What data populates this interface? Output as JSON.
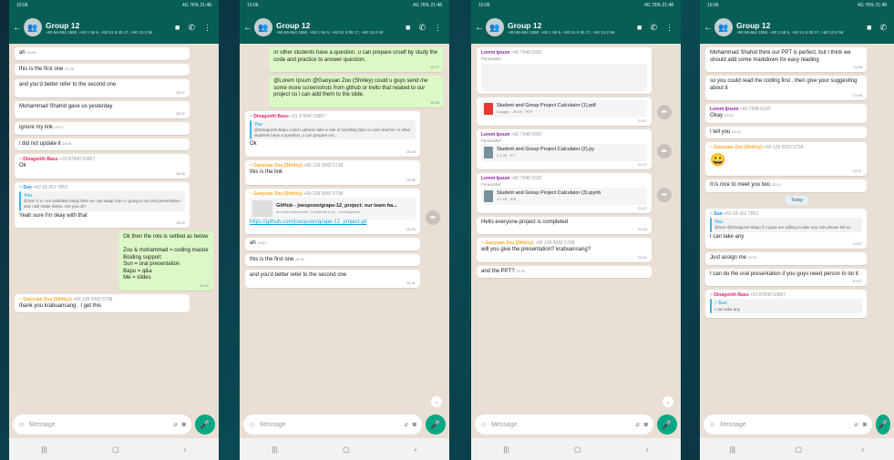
{
  "header": {
    "title": "Group 12",
    "subtitle": "+60 66-564 1950, +60 1 56 6, +60 51 5 05 17, +60 13-2 56",
    "statusbar_time": "10:06",
    "statusbar_right": "4G 76% 21:48"
  },
  "input": {
    "placeholder": "Message"
  },
  "nav": {
    "recent": "|||",
    "home": "▢",
    "back": "‹"
  },
  "colors": {
    "header": "#075e54",
    "outgoing": "#dcf8c6",
    "accent": "#00a884",
    "chat_bg": "#e9dfd5"
  },
  "phone1": {
    "messages": [
      {
        "text": "ah",
        "time": "15:26"
      },
      {
        "text": "this is the first one",
        "time": "15:26"
      },
      {
        "text": "and you'd better refer to the second one",
        "time": "15:27"
      },
      {
        "text": "Mohammad Shahid gave us yesterday",
        "time": "15:27"
      },
      {
        "text": "ignore my link",
        "time": "15:27"
      },
      {
        "text": "i did not update it",
        "time": "15:28"
      },
      {
        "sender": "~ Dinagonth Basu",
        "phone": "+91 87840 03857",
        "text": "Ok",
        "time": "15:28"
      },
      {
        "sender": "~ Sun",
        "phone": "+60 18-362 7853",
        "quote_name": "You",
        "quote": "@Sun If u i not available today then we can swap role u r going to do oral presentation and i will make slides. Are you ok?",
        "text": "Yeah sure I'm okay with that",
        "time": "15:29"
      },
      {
        "text": "Ok then the role is settled as below\n\nZou & mohammad = coding master\nBoiding support\nSun = oral presentation\nBapu = q&a\nMe = slides",
        "time": "15:30"
      },
      {
        "sender": "~ Gaoyuan Zou (Shirley)",
        "phone": "+60 128 0082 5738",
        "text": "thank you krabuansang . I get this",
        "time": "15:30"
      }
    ]
  },
  "phone2": {
    "messages": [
      {
        "text": "or other students have a question. u can prepare urself by study the code and practice to answer question.",
        "time": "15:27"
      },
      {
        "text": "@Lorem Ipsum @Gaoyuan Zou (Shirley) could u guys send me some more screenshots from github or trello that related to our project so i can add them to the slide.",
        "time": "15:28"
      },
      {
        "sender": "~ Dinagonth Basu",
        "phone": "+91 87840 03857",
        "quote_name": "You",
        "quote": "@Dinagonth Bapu could u please take a role of handling Q&A in case teacher or other students have a question. u can prepare urs...",
        "text": "Ok",
        "time": "15:29"
      },
      {
        "sender": "~ Gaoyuan Zou (Shirley)",
        "phone": "+60 128 0082 5738",
        "text": "this is the link",
        "time": "15:30"
      },
      {
        "sender": "~ Gaoyuan Zou (Shirley)",
        "phone": "+60 128 0082 5738",
        "preview_title": "GitHub - joespoon/grape-12_project: our team ha...",
        "preview_desc": "our team homework. Contribute to jo... development",
        "link": "https://github.com/joespoon/grape-12_project.git",
        "time": "15:30"
      },
      {
        "text": "ah",
        "time": "15:31"
      },
      {
        "text": "this is the first one",
        "time": "15:31"
      },
      {
        "text": "and you'd better refer to the second one",
        "time": "15:31"
      }
    ]
  },
  "phone3": {
    "messages": [
      {
        "sender": "Lorem Ipsum",
        "phone": "+60 7948 0320",
        "forwarded": "Forwarded",
        "file_name": "",
        "file_meta": "",
        "time": ""
      },
      {
        "file_name": "Student and Group Project Calculator (1).pdf",
        "file_meta": "5 pages · 25 kB · PDF",
        "time": "21:47"
      },
      {
        "sender": "Lorem Ipsum",
        "phone": "+60 7948 0320",
        "forwarded": "Forwarded",
        "file_name": "Student and Group Project Calculator (2).py",
        "file_meta": "2.1 kB · PY",
        "time": "21:47"
      },
      {
        "sender": "Lorem Ipsum",
        "phone": "+60 7948 0320",
        "forwarded": "Forwarded",
        "file_name": "Student and Group Project Calculator (3).ipynb",
        "file_meta": "3.1 kB · IPB",
        "time": "21:47"
      },
      {
        "text": "Hello everyone project is completed",
        "time": "21:49"
      },
      {
        "sender": "~ Gaoyuan Zou (Shirley)",
        "phone": "+60 128 0082 5738",
        "text": "will you give the presentation? krabuansang?",
        "time": "21:51"
      },
      {
        "text": "and the PPT?",
        "time": "21:51"
      }
    ]
  },
  "phone4": {
    "messages": [
      {
        "text": "Mohammad Shahid think our PPT is perfect, but I think we should add some markdown for easy reading",
        "time": "21:58"
      },
      {
        "text": "so you could read the coding first , then give your suggesting about it",
        "time": "21:58"
      },
      {
        "sender": "Lorem Ipsum",
        "phone": "+60 7948 0320",
        "text": "Okay",
        "time": "22:00"
      },
      {
        "text": "I tell you",
        "time": "22:01"
      },
      {
        "sender": "~ Gaoyuan Zou (Shirley)",
        "phone": "+60 128 0082 5738",
        "emoji": "😀",
        "time": "22:01"
      },
      {
        "text": "It is nice to meet you two",
        "time": "22:02"
      },
      {
        "date": "Today"
      },
      {
        "sender": "~ Sun",
        "phone": "+60 18-362 7853",
        "quote_name": "You",
        "quote": "@Sun @Dinagonth Bapu if u guys are willing to take any role please tell us",
        "text": "I can take any",
        "time": "01:57"
      },
      {
        "text": "Just assign me",
        "time": "01:57"
      },
      {
        "text": "I can do the oral presentation if you guys need person to do it",
        "time": "01:57"
      },
      {
        "sender": "~ Dinagonth Basu",
        "phone": "+91 87840 03857",
        "quote_name": "~ Sun",
        "quote": "I can take any",
        "text": "",
        "time": ""
      }
    ]
  }
}
